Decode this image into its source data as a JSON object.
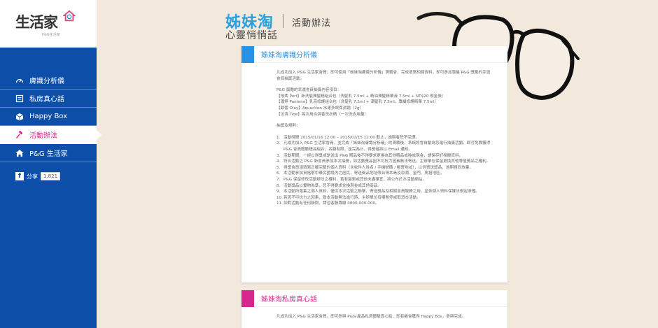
{
  "sidebar": {
    "logo": "生活家",
    "logo_sub": "P&G生活家",
    "items": [
      {
        "label": "膚識分析儀",
        "icon": "gauge-icon"
      },
      {
        "label": "私房真心話",
        "icon": "form-icon"
      },
      {
        "label": "Happy Box",
        "icon": "box-icon"
      },
      {
        "label": "活動辦法",
        "icon": "gavel-icon",
        "active": true
      },
      {
        "label": "P&G 生活家",
        "icon": "home-icon"
      }
    ],
    "share_label": "分享",
    "share_count": "1,821"
  },
  "header": {
    "brand_title": "姊妹淘",
    "brand_sub": "心靈悄悄話",
    "page_title": "活動辦法"
  },
  "card1": {
    "title": "姊妹淘膚識分析儀",
    "accent": "#2a90e0",
    "intro": "凡成功加入 P&G 生活家會員，即可使用「姊妹淘膚識分析儀」測驗會，完成填寫相關資料，即可參加專屬 P&G 獎勵的幸運會員抽獎活動。",
    "prize_head": "P&G 獎勵的幸運會員抽獎內容項目：",
    "prizes": [
      "【飛柔 Pert】新洗髮潤髮精組合包（洗髮乳 7.5ml + 精油潤髮精華液 7.5ml + NT$20 現金券）",
      "【潘婷 Pantene】乳液修護組合包（洗髮乳 7.5ml + 潤髮乳 7.5ml，專屬修護精華 7.5ml）",
      "【歐蕾 Olay】Aquaction 水漾多效保濕霜（2g）",
      "【汰漬 Tide】每次用合併香洗衣精（一次洗衣用量）"
    ],
    "rules_head": "抽獎及規則：",
    "rules": [
      "活動時間 2015/01/16 12:00 – 2015/02/15 12:00 截止，逾期者恕不受理。",
      "凡成功加入 P&G 生活家會員，並完成「姊妹淘膚識分析儀」的測驗後，系統將會自動為您進行抽獎活動，即可免費獲得 P&G 會員體驗禮品組合，名額有限，送完為止，得獎者將以 Email 通知。",
      "活動期間，一經以得獎或是送出 P&G 贈品後不得要求更換為其他贈品或換成現金，請保存好相關資料。",
      "符合活動之 P&G 新會員參加本次抽獎，如活動獎品因不可抗力因素無法寄送，主辦單位保留更換其他等值獎品之權利。",
      "得獎會員須填寫正確完整的個人資料（含收件人姓名 / 手機號碼 / 郵寄地址），以供寄送獎品，逾期視同放棄。",
      "本活動參加資格限中華民國境內之居民，寄送獎品地址限台灣本島及澎湖、金門、馬祖地區。",
      "P&G 保留修改活動辦法之權利，若有變更或其他未盡事宜，將公布於本活動網站。",
      "活動獎品以實物為準，恕不得要求兌換現金或其他商品。",
      "本活動所蒐集之個人資料，僅供本次活動之聯繫、寄送獎品及相關會員服務之用，並依個人資料保護法規定辦理。",
      "若因不可抗力之因素，致本活動無法進行時，主辦單位有權暫停或取消本活動。",
      "如對活動有任何疑問，請洽客服專線 0800-000-000。"
    ]
  },
  "card2": {
    "title": "姊妹淘私房真心話",
    "accent": "#d6278c",
    "intro": "凡成功加入 P&G 生活家會員，即可參與 P&G 產品私房體驗真心話，即有機會獲得 Happy Box，參與完成。"
  },
  "colors": {
    "sidebar": "#0d4ea8",
    "active": "#d6278c",
    "brand": "#2aa0dc",
    "background": "#f3e8dc"
  }
}
